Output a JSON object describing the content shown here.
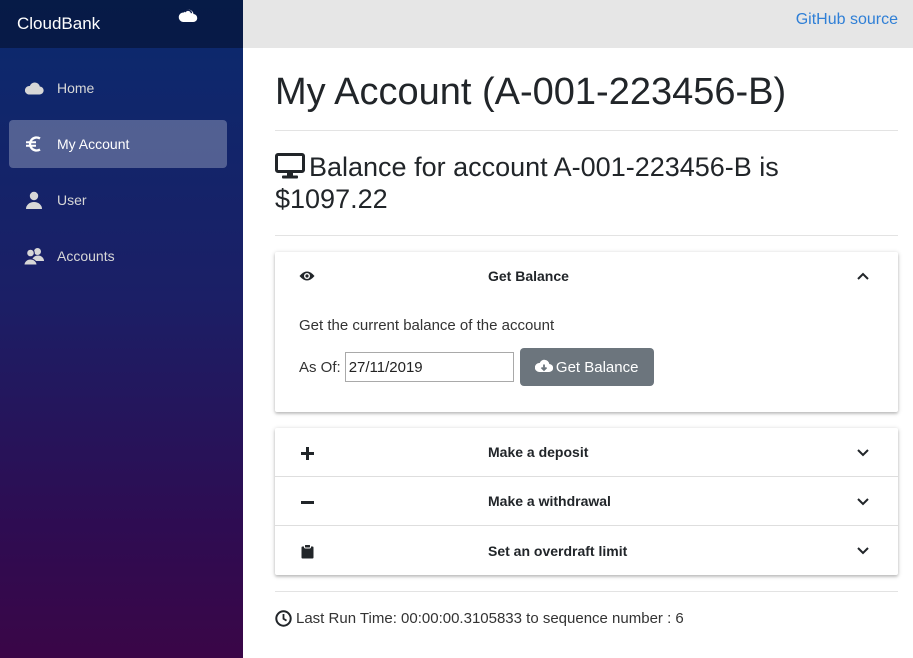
{
  "app": {
    "brand": "CloudBank",
    "brand_icon": "cloud-icon"
  },
  "sidebar": {
    "items": [
      {
        "label": "Home",
        "icon": "cloud-icon",
        "active": false
      },
      {
        "label": "My Account",
        "icon": "euro-icon",
        "active": true
      },
      {
        "label": "User",
        "icon": "user-icon",
        "active": false
      },
      {
        "label": "Accounts",
        "icon": "users-icon",
        "active": false
      }
    ]
  },
  "topbar": {
    "link": "GitHub source"
  },
  "main": {
    "title": "My Account (A-001-223456-B)",
    "balance_text": "Balance for account A-001-223456-B is $1097.22",
    "balance_icon": "monitor-icon"
  },
  "get_balance": {
    "title": "Get Balance",
    "icon": "eye-icon",
    "description": "Get the current balance of the account",
    "as_of_label": "As Of:",
    "as_of_value": "27/11/2019",
    "button_label": "Get Balance",
    "button_icon": "cloud-download-icon"
  },
  "actions": [
    {
      "title": "Make a deposit",
      "icon": "plus-icon"
    },
    {
      "title": "Make a withdrawal",
      "icon": "minus-icon"
    },
    {
      "title": "Set an overdraft limit",
      "icon": "clipboard-icon"
    }
  ],
  "footer": {
    "text": "Last Run Time: 00:00:00.3105833 to sequence number : 6",
    "icon": "clock-icon"
  },
  "colors": {
    "button": "#6c757d",
    "link": "#2f7fd6",
    "sidebar_top": "#0a2a6e",
    "sidebar_bottom": "#3a0647"
  }
}
